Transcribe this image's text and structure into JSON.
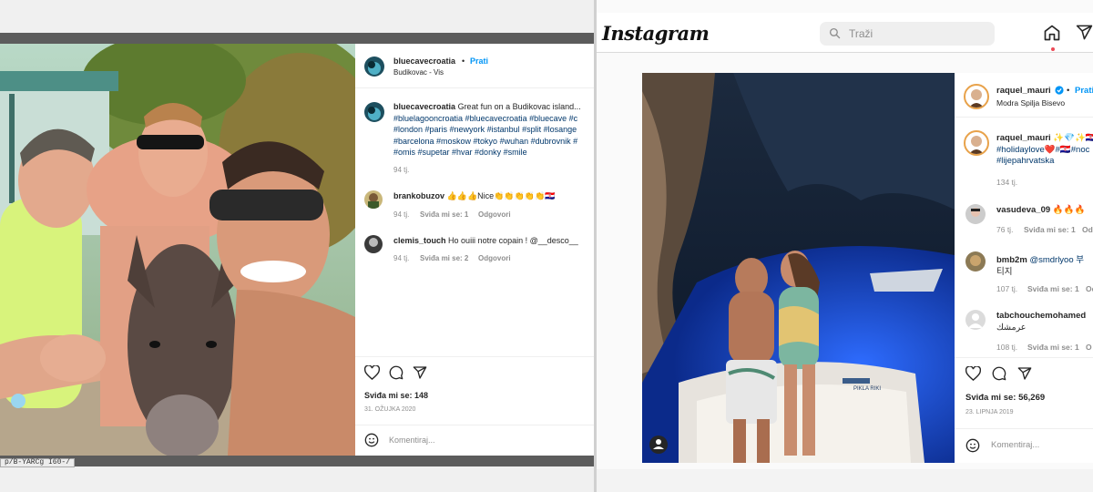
{
  "left_post": {
    "url_tooltip": "p/B-YARCg I60-/",
    "username": "bluecavecroatia",
    "dot": "•",
    "follow_label": "Prati",
    "location": "Budikovac - Vis",
    "caption_text": "Great fun on a Budikovac island...",
    "hashtags_line1": "#bluelagooncroatia #bluecavecroatia #bluecave #c",
    "hashtags_line2": "#london #paris #newyork #istanbul #split #losange",
    "hashtags_line3": "#barcelona #moskow #tokyo #wuhan #dubrovnik #",
    "hashtags_line4": "#omis #supetar #hvar #donky #smile",
    "caption_time": "94 tj.",
    "comments": [
      {
        "user": "brankobuzov",
        "text": "👍👍👍Nice👏👏👏👏👏🇭🇷",
        "time": "94 tj.",
        "likes": "Sviđa mi se: 1",
        "reply": "Odgovori"
      },
      {
        "user": "clemis_touch",
        "text": "Ho ouiii notre copain ! @__desco__",
        "time": "94 tj.",
        "likes": "Sviđa mi se: 2",
        "reply": "Odgovori"
      }
    ],
    "likes_total": "Sviđa mi se: 148",
    "date": "31. OŽUJKA 2020",
    "comment_placeholder": "Komentiraj..."
  },
  "right_post": {
    "logo": "Instagram",
    "search_placeholder": "Traži",
    "username": "raquel_mauri",
    "dot": "•",
    "follow_label": "Prati",
    "location": "Modra Spilja Bisevo",
    "caption_line1": "✨💎✨🇭🇷",
    "caption_line2": "#holidaylove❤️#🇭🇷#noc",
    "caption_line3": "#lijepahrvatska",
    "caption_time": "134 tj.",
    "comments": [
      {
        "user": "vasudeva_09",
        "text": "🔥🔥🔥",
        "time": "76 tj.",
        "likes": "Sviđa mi se: 1",
        "reply": "Od"
      },
      {
        "user": "bmb2m",
        "text": "@smdrlyoo 부",
        "text2": "티지",
        "time": "107 tj.",
        "likes": "Sviđa mi se: 1",
        "reply": "Od"
      },
      {
        "user": "tabchouchemohamed",
        "text": "عرمشك",
        "time": "108 tj.",
        "likes": "Sviđa mi se: 1",
        "reply": "O"
      }
    ],
    "likes_total": "Sviđa mi se: 56,269",
    "date": "23. LIPNJA 2019",
    "comment_placeholder": "Komentiraj...",
    "boat_text": "PIKLA RIKI"
  }
}
